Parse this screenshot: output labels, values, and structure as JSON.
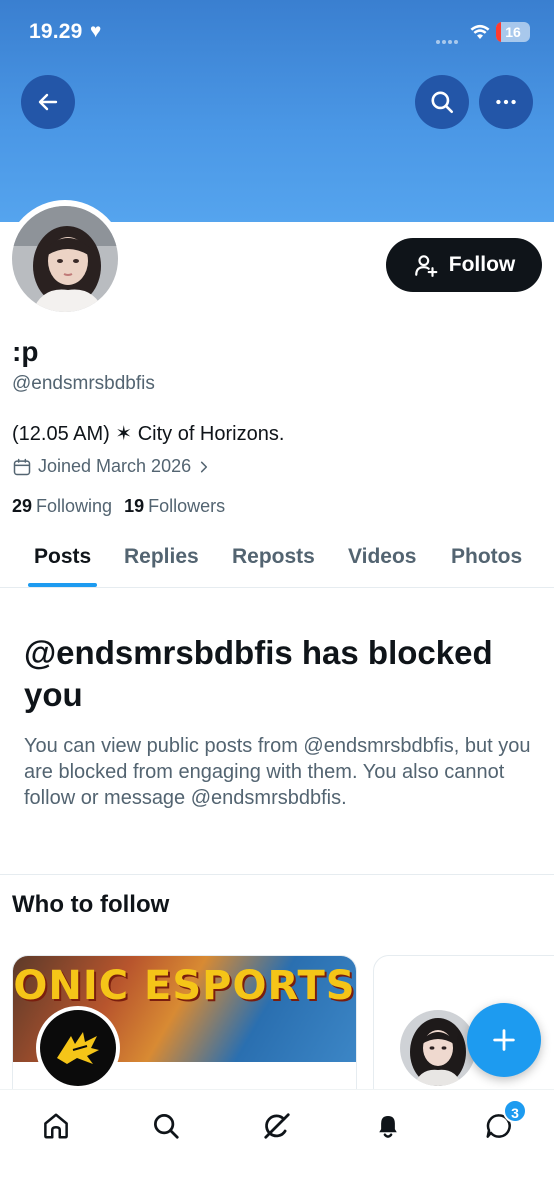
{
  "status_bar": {
    "time": "19.29",
    "battery": "16"
  },
  "profile": {
    "display_name": ":p",
    "handle": "@endsmrsbdbfis",
    "bio": "(12.05 AM) ✶ City of Horizons.",
    "joined": "Joined March 2026",
    "following_count": "29",
    "following_label": "Following",
    "followers_count": "19",
    "followers_label": "Followers",
    "follow_button": "Follow"
  },
  "tabs": [
    {
      "label": "Posts",
      "active": true
    },
    {
      "label": "Replies",
      "active": false
    },
    {
      "label": "Reposts",
      "active": false
    },
    {
      "label": "Videos",
      "active": false
    },
    {
      "label": "Photos",
      "active": false
    }
  ],
  "blocked": {
    "title": "@endsmrsbdbfis has blocked you",
    "message": "You can view public posts from @endsmrsbdbfis, but you are blocked from engaging with them. You also cannot follow or message @endsmrsbdbfis."
  },
  "who_to_follow": {
    "title": "Who to follow",
    "cards": [
      {
        "banner_text": "ONIC ESPORTS"
      },
      {}
    ]
  },
  "bottom_nav": {
    "items": [
      "home-icon",
      "search-icon",
      "grok-icon",
      "notifications-icon",
      "messages-icon"
    ],
    "messages_badge": "3"
  },
  "colors": {
    "accent": "#1d9bf0",
    "banner": "#4b98e6",
    "dark": "#0f1419",
    "muted": "#536471"
  }
}
